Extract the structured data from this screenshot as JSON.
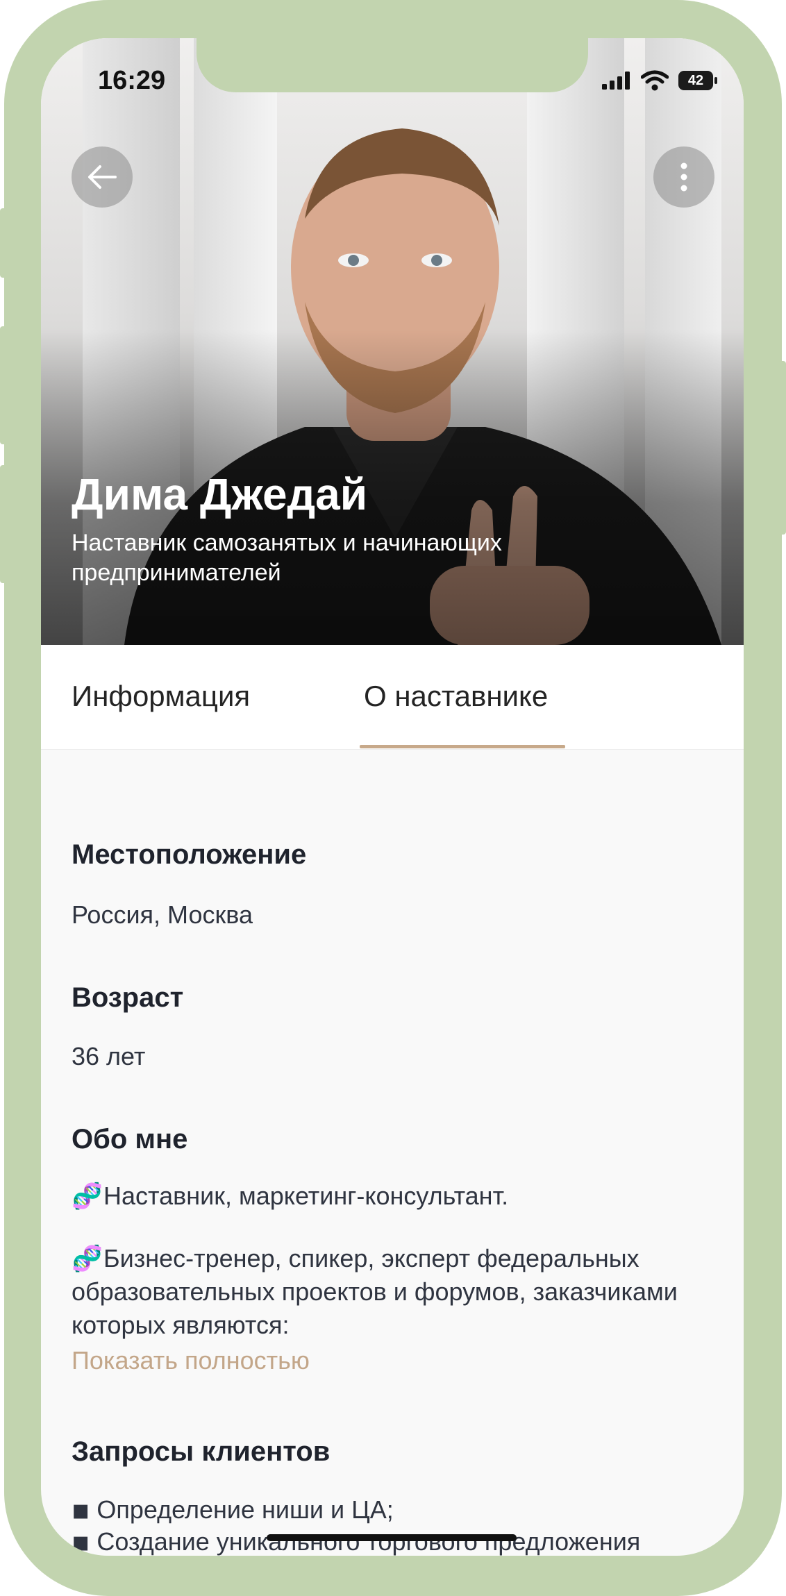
{
  "status_bar": {
    "time": "16:29",
    "battery": "42"
  },
  "profile": {
    "name": "Дима Джедай",
    "subtitle": "Наставник самозанятых и начинающих предпринимателей"
  },
  "tabs": [
    {
      "label": "Информация",
      "active": false
    },
    {
      "label": "О наставнике",
      "active": true
    }
  ],
  "location": {
    "title": "Местоположение",
    "value": "Россия, Москва"
  },
  "age": {
    "title": "Возраст",
    "value": "36 лет"
  },
  "about": {
    "title": "Обо мне",
    "emoji": "🧬",
    "paragraph_1": "Наставник, маркетинг-консультант.",
    "paragraph_2": "Бизнес-тренер, спикер, эксперт федеральных образовательных проектов и форумов, заказчиками которых являются:",
    "show_more": "Показать полностью"
  },
  "requests": {
    "title": "Запросы клиентов",
    "bullet": "◾",
    "items": [
      "Определение ниши и ЦА;",
      "Создание уникального торгового предложения премиального продукта за счёт глубинного"
    ]
  },
  "colors": {
    "frame": "#c2d4af",
    "accent": "#c7a98a",
    "link": "#c3a689",
    "text": "#1f232d"
  },
  "icons": {
    "back": "arrow-left-icon",
    "menu": "more-vertical-icon",
    "signal": "cellular-signal-icon",
    "wifi": "wifi-icon",
    "battery": "battery-icon"
  }
}
